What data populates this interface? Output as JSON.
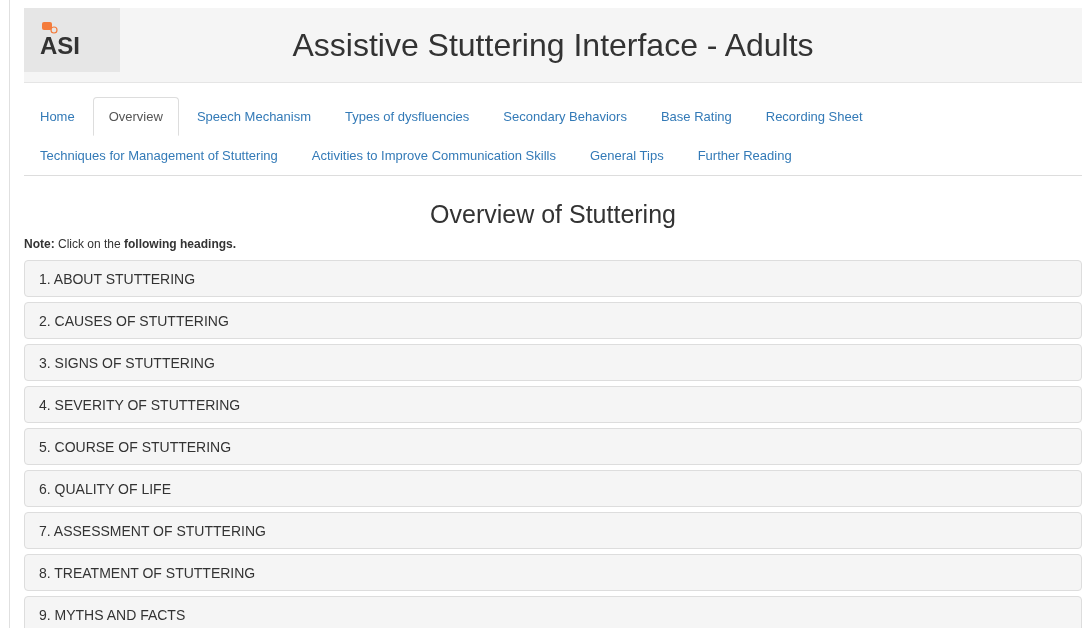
{
  "header": {
    "logo": "ASI",
    "title": "Assistive Stuttering Interface - Adults"
  },
  "tabs": [
    {
      "label": "Home",
      "selected": false
    },
    {
      "label": "Overview",
      "selected": true
    },
    {
      "label": "Speech Mechanism",
      "selected": false
    },
    {
      "label": "Types of dysfluencies",
      "selected": false
    },
    {
      "label": "Secondary Behaviors",
      "selected": false
    },
    {
      "label": "Base Rating",
      "selected": false
    },
    {
      "label": "Recording Sheet",
      "selected": false
    },
    {
      "label": "Techniques for Management of Stuttering",
      "selected": false
    },
    {
      "label": "Activities to Improve Communication Skills",
      "selected": false
    },
    {
      "label": "General Tips",
      "selected": false
    },
    {
      "label": "Further Reading",
      "selected": false
    }
  ],
  "heading": "Overview of Stuttering",
  "note": "**Note:** Click on the **following headings.**",
  "sections": [
    "1. ABOUT STUTTERING",
    "2. CAUSES OF STUTTERING",
    "3. SIGNS OF STUTTERING",
    "4. SEVERITY OF STUTTERING",
    "5. COURSE OF STUTTERING",
    "6. QUALITY OF LIFE",
    "7. ASSESSMENT OF STUTTERING",
    "8. TREATMENT OF STUTTERING",
    "9. MYTHS AND FACTS"
  ]
}
